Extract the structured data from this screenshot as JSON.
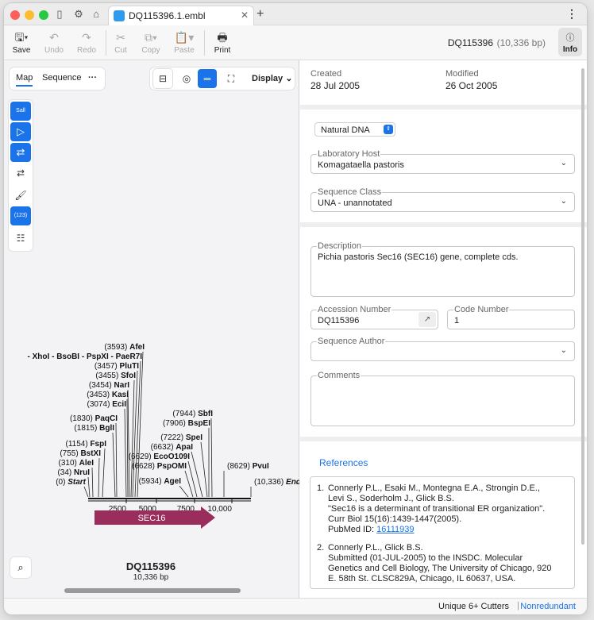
{
  "tab": {
    "title": "DQ115396.1.embl",
    "close": "✕",
    "new": "+"
  },
  "toolbar": {
    "save": "Save",
    "undo": "Undo",
    "redo": "Redo",
    "cut": "Cut",
    "copy": "Copy",
    "paste": "Paste",
    "print": "Print",
    "info": "Info",
    "seq_name": "DQ115396",
    "seq_length": "(10,336 bp)"
  },
  "left": {
    "tabs": [
      "Map",
      "Sequence"
    ],
    "more": "···",
    "display": "Display",
    "sidebar_badge_sall": "Sall",
    "sidebar_badge_123": "(123)",
    "map_title": "DQ115396",
    "map_subtitle": "10,336 bp"
  },
  "map": {
    "sites": [
      {
        "pos": "(3593)",
        "name": "AfeI"
      },
      {
        "pos": "",
        "name": "- XhoI - BsoBI - PspXI - PaeR7I"
      },
      {
        "pos": "(3457)",
        "name": "PluTI"
      },
      {
        "pos": "(3455)",
        "name": "SfoI"
      },
      {
        "pos": "(3454)",
        "name": "NarI"
      },
      {
        "pos": "(3453)",
        "name": "KasI"
      },
      {
        "pos": "(3074)",
        "name": "EciI"
      },
      {
        "pos": "(1830)",
        "name": "PaqCI"
      },
      {
        "pos": "(1815)",
        "name": "BglI"
      },
      {
        "pos": "(1154)",
        "name": "FspI"
      },
      {
        "pos": "(755)",
        "name": "BstXI"
      },
      {
        "pos": "(310)",
        "name": "AleI"
      },
      {
        "pos": "(34)",
        "name": "NruI"
      },
      {
        "pos": "(0)",
        "name": "Start"
      },
      {
        "pos": "(7944)",
        "name": "SbfI"
      },
      {
        "pos": "(7906)",
        "name": "BspEI"
      },
      {
        "pos": "(7222)",
        "name": "SpeI"
      },
      {
        "pos": "(6632)",
        "name": "ApaI"
      },
      {
        "pos": "(6629)",
        "name": "EcoO109I"
      },
      {
        "pos": "(6628)",
        "name": "PspOMI"
      },
      {
        "pos": "(5934)",
        "name": "AgeI"
      },
      {
        "pos": "(8629)",
        "name": "PvuI"
      },
      {
        "pos": "(10,336)",
        "name": "End"
      }
    ],
    "ruler": [
      "2500",
      "5000",
      "7500",
      "10,000"
    ],
    "feature": "SEC16",
    "feature_color": "#9b2d5c"
  },
  "info": {
    "created_label": "Created",
    "created": "28 Jul 2005",
    "modified_label": "Modified",
    "modified": "26 Oct 2005",
    "molecule": "Natural DNA",
    "lab_host_label": "Laboratory Host",
    "lab_host": "Komagataella pastoris",
    "seq_class_label": "Sequence Class",
    "seq_class": "UNA - unannotated",
    "description_label": "Description",
    "description": "Pichia pastoris Sec16 (SEC16) gene, complete cds.",
    "accession_label": "Accession Number",
    "accession": "DQ115396",
    "code_label": "Code Number",
    "code": "1",
    "author_label": "Sequence Author",
    "author": "",
    "comments_label": "Comments",
    "comments": "",
    "references_title": "References",
    "references": [
      {
        "num": "1.",
        "lines": [
          "Connerly P.L., Esaki M., Montegna E.A., Strongin D.E.,",
          "Levi S., Soderholm J., Glick B.S.",
          "\"Sec16 is a determinant of transitional ER organization\".",
          "Curr Biol 15(16):1439-1447(2005)."
        ],
        "pubmed_label": "PubMed ID:",
        "pubmed": "16111939"
      },
      {
        "num": "2.",
        "lines": [
          "Connerly P.L., Glick B.S.",
          "Submitted (01-JUL-2005) to the INSDC. Molecular",
          "Genetics and Cell Biology, The University of Chicago, 920",
          "E. 58th St. CLSC829A, Chicago, IL 60637, USA."
        ]
      }
    ]
  },
  "status": {
    "cutters": "Unique 6+ Cutters",
    "sep": "|",
    "mode": "Nonredundant"
  }
}
